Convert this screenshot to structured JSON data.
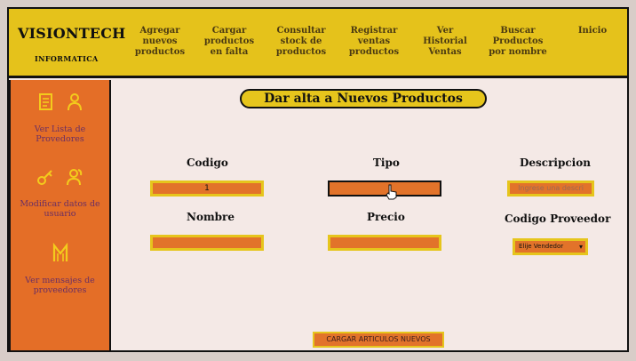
{
  "brand": {
    "name": "VISIONTECH",
    "subtitle": "INFORMATICA"
  },
  "nav": [
    {
      "label": "Agregar\nnuevos\nproductos"
    },
    {
      "label": "Cargar\nproductos\nen falta"
    },
    {
      "label": "Consultar\nstock de\nproductos"
    },
    {
      "label": "Registrar\nventas\nproductos"
    },
    {
      "label": "Ver\nHistorial\nVentas"
    },
    {
      "label": "Buscar\nProductos\npor nombre"
    },
    {
      "label": "Inicio"
    }
  ],
  "sidebar": [
    {
      "label": "Ver Lista de Provedores",
      "icons": [
        "document-icon",
        "user-icon"
      ]
    },
    {
      "label": "Modificar datos de usuario",
      "icons": [
        "key-icon",
        "users-icon"
      ]
    },
    {
      "label": "Ver mensajes de proveedores",
      "icons": [
        "m-logo-icon"
      ]
    }
  ],
  "form": {
    "title": "Dar alta a Nuevos Productos",
    "codigo_label": "Codigo",
    "codigo_value": "1",
    "tipo_label": "Tipo",
    "tipo_value": "",
    "descripcion_label": "Descripcion",
    "descripcion_placeholder": "Ingrese una descri",
    "nombre_label": "Nombre",
    "nombre_value": "",
    "precio_label": "Precio",
    "precio_value": "",
    "proveedor_label": "Codigo Proveedor",
    "proveedor_selected": "Elije Vendedor",
    "submit_label": "CARGAR ARTICULOS NUEVOS"
  },
  "colors": {
    "header": "#e5c21b",
    "sidebar": "#e46e27",
    "input": "#e2732a",
    "label_text": "#6a2e63"
  }
}
